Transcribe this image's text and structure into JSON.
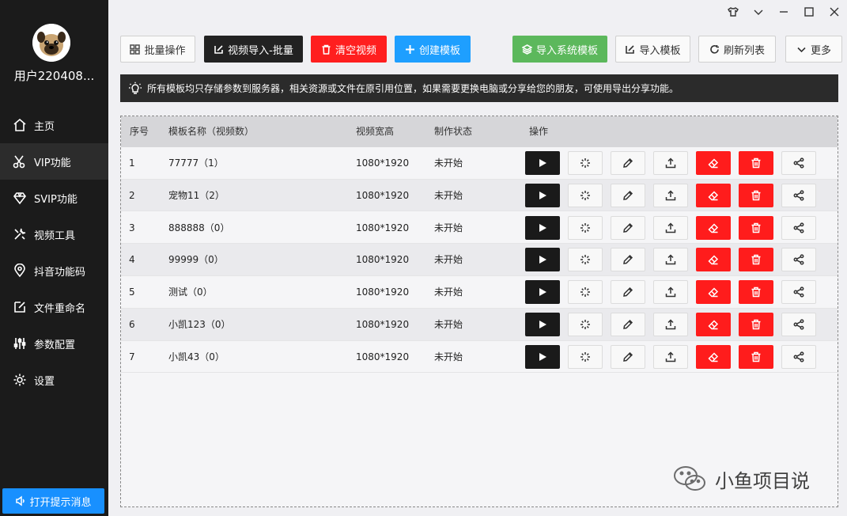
{
  "window": {
    "controls": [
      "skin-icon",
      "chevron-down-icon",
      "minimize-icon",
      "maximize-icon",
      "close-icon"
    ]
  },
  "sidebar": {
    "username": "用户220408...",
    "items": [
      {
        "label": "主页",
        "icon": "home-icon",
        "active": false
      },
      {
        "label": "VIP功能",
        "icon": "scissors-icon",
        "active": true
      },
      {
        "label": "SVIP功能",
        "icon": "diamond-icon",
        "active": false
      },
      {
        "label": "视频工具",
        "icon": "tools-icon",
        "active": false
      },
      {
        "label": "抖音功能码",
        "icon": "location-pin-icon",
        "active": false
      },
      {
        "label": "文件重命名",
        "icon": "edit-file-icon",
        "active": false
      },
      {
        "label": "参数配置",
        "icon": "sliders-icon",
        "active": false
      },
      {
        "label": "设置",
        "icon": "gear-icon",
        "active": false
      }
    ],
    "notice_button": "打开提示消息"
  },
  "toolbar": {
    "batch": "批量操作",
    "import_batch": "视频导入-批量",
    "clear_video": "清空视频",
    "create_template": "创建模板",
    "import_system": "导入系统模板",
    "import_template": "导入模板",
    "refresh": "刷新列表",
    "more": "更多"
  },
  "info": {
    "text": "所有模板均只存储参数到服务器，相关资源或文件在原引用位置，如果需要更换电脑或分享给您的朋友，可使用导出分享功能。"
  },
  "table": {
    "headers": {
      "index": "序号",
      "name": "模板名称（视频数）",
      "size": "视频宽高",
      "status": "制作状态",
      "actions": "操作"
    },
    "rows": [
      {
        "index": "1",
        "name": "77777（1）",
        "size": "1080*1920",
        "status": "未开始"
      },
      {
        "index": "2",
        "name": "宠物11（2）",
        "size": "1080*1920",
        "status": "未开始"
      },
      {
        "index": "3",
        "name": "888888（0）",
        "size": "1080*1920",
        "status": "未开始"
      },
      {
        "index": "4",
        "name": "99999（0）",
        "size": "1080*1920",
        "status": "未开始"
      },
      {
        "index": "5",
        "name": "测试（0）",
        "size": "1080*1920",
        "status": "未开始"
      },
      {
        "index": "6",
        "name": "小凯123（0）",
        "size": "1080*1920",
        "status": "未开始"
      },
      {
        "index": "7",
        "name": "小凯43（0）",
        "size": "1080*1920",
        "status": "未开始"
      }
    ],
    "action_icons": [
      "play-icon",
      "sparkle-icon",
      "pencil-icon",
      "upload-icon",
      "eraser-icon",
      "trash-icon",
      "share-icon"
    ]
  },
  "watermark": {
    "text": "小鱼项目说"
  },
  "colors": {
    "sidebar_bg": "#1b1b1b",
    "accent_blue": "#1e9fff",
    "danger_red": "#ff1f1f",
    "success_green": "#5cb85c",
    "dark_button": "#222222"
  }
}
